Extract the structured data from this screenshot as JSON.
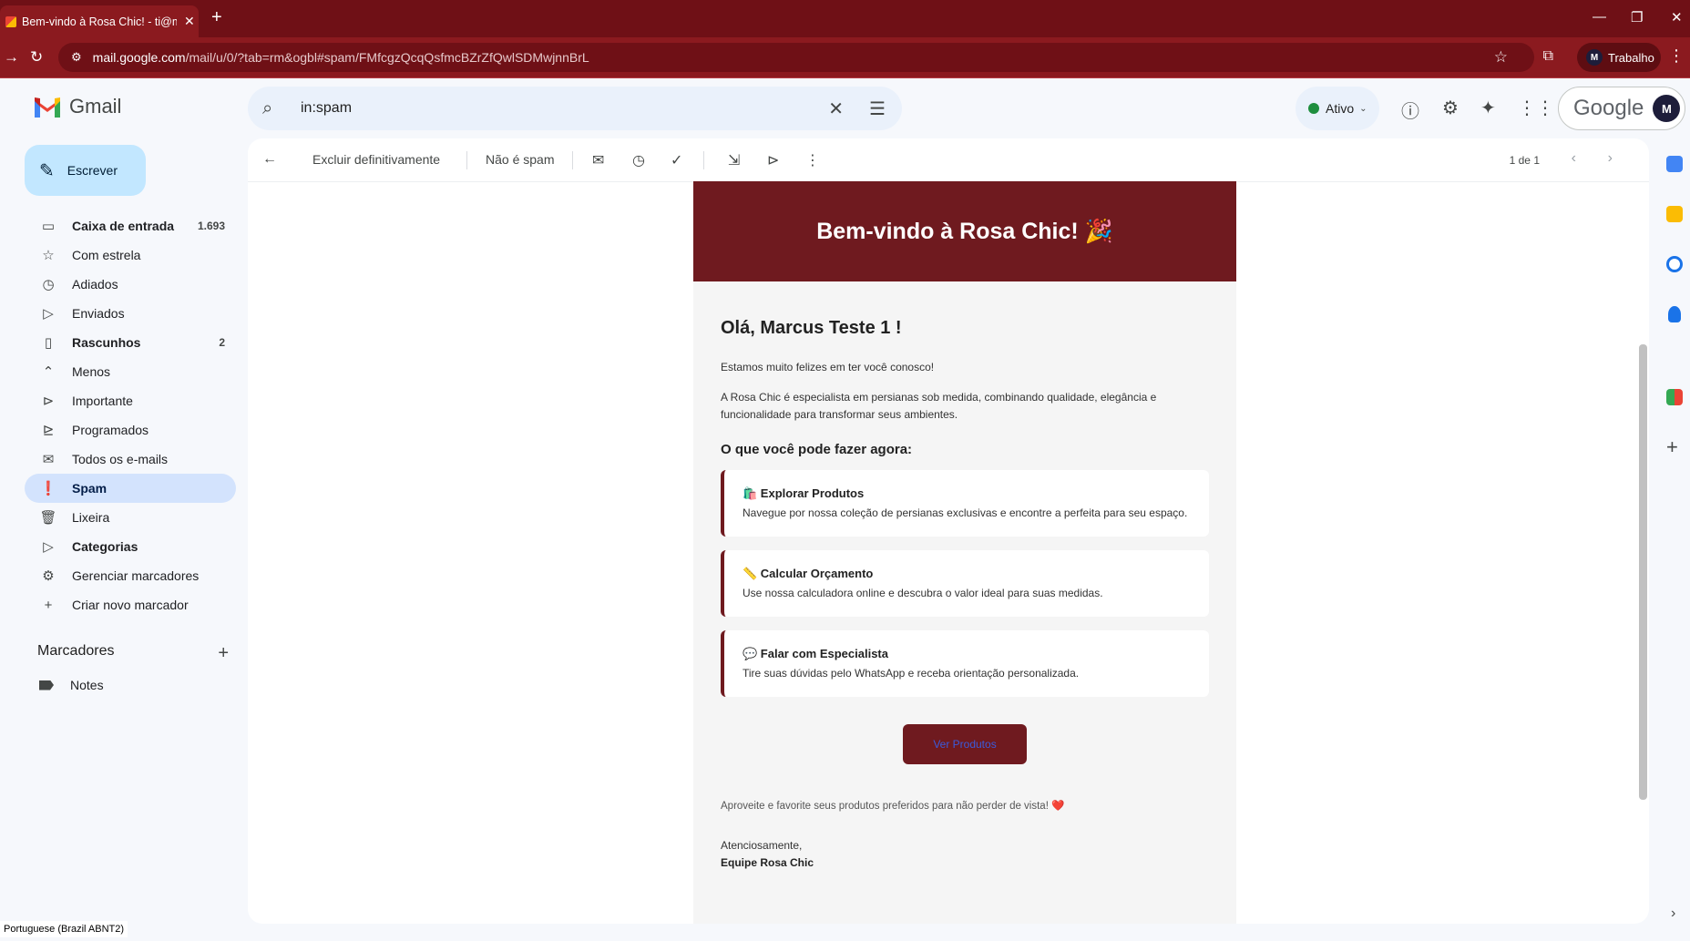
{
  "browser": {
    "tab_title": "Bem-vindo à Rosa Chic! - ti@m",
    "url_host": "mail.google.com",
    "url_path": "/mail/u/0/?tab=rm&ogbl#spam/FMfcgzQcqQsfmcBZrZfQwlSDMwjnnBrL",
    "profile_label": "Trabalho",
    "profile_initial": "M"
  },
  "gmail": {
    "app_name": "Gmail",
    "search_query": "in:spam",
    "status": "Ativo",
    "google_word": "Google",
    "account_initial": "M"
  },
  "sidebar": {
    "compose_label": "Escrever",
    "items": [
      {
        "label": "Caixa de entrada",
        "count": "1.693",
        "icon": "inbox-icon",
        "glyph": "▭",
        "bold": true
      },
      {
        "label": "Com estrela",
        "count": "",
        "icon": "star-icon",
        "glyph": "☆"
      },
      {
        "label": "Adiados",
        "count": "",
        "icon": "clock-icon",
        "glyph": "◷"
      },
      {
        "label": "Enviados",
        "count": "",
        "icon": "send-icon",
        "glyph": "▷"
      },
      {
        "label": "Rascunhos",
        "count": "2",
        "icon": "draft-icon",
        "glyph": "▯",
        "bold": true
      },
      {
        "label": "Menos",
        "count": "",
        "icon": "chevron-up-icon",
        "glyph": "⌃"
      },
      {
        "label": "Importante",
        "count": "",
        "icon": "important-icon",
        "glyph": "⊳"
      },
      {
        "label": "Programados",
        "count": "",
        "icon": "scheduled-icon",
        "glyph": "⊵"
      },
      {
        "label": "Todos os e-mails",
        "count": "",
        "icon": "all-mail-icon",
        "glyph": "✉"
      },
      {
        "label": "Spam",
        "count": "",
        "icon": "spam-icon",
        "glyph": "❗",
        "active": true
      },
      {
        "label": "Lixeira",
        "count": "",
        "icon": "trash-icon",
        "glyph": "🗑"
      },
      {
        "label": "Categorias",
        "count": "",
        "icon": "label-icon",
        "glyph": "▷",
        "bold": true
      },
      {
        "label": "Gerenciar marcadores",
        "count": "",
        "icon": "gear-icon",
        "glyph": "⚙"
      },
      {
        "label": "Criar novo marcador",
        "count": "",
        "icon": "plus-icon",
        "glyph": "+"
      }
    ],
    "labels_title": "Marcadores",
    "labels": [
      {
        "label": "Notes"
      }
    ]
  },
  "toolbar": {
    "delete_forever": "Excluir definitivamente",
    "not_spam": "Não é spam",
    "pager": "1 de 1"
  },
  "email": {
    "hero_title": "Bem-vindo à Rosa Chic! 🎉",
    "greeting": "Olá, Marcus Teste 1 !",
    "intro": "Estamos muito felizes em ter você conosco!",
    "about": "A Rosa Chic é especialista em persianas sob medida, combinando qualidade, elegância e funcionalidade para transformar seus ambientes.",
    "subtitle": "O que você pode fazer agora:",
    "cards": [
      {
        "title": "🛍️ Explorar Produtos",
        "text": "Navegue por nossa coleção de persianas exclusivas e encontre a perfeita para seu espaço."
      },
      {
        "title": "📏 Calcular Orçamento",
        "text": "Use nossa calculadora online e descubra o valor ideal para suas medidas."
      },
      {
        "title": "💬 Falar com Especialista",
        "text": "Tire suas dúvidas pelo WhatsApp e receba orientação personalizada."
      }
    ],
    "cta": "Ver Produtos",
    "footer_note": "Aproveite e favorite seus produtos preferidos para não perder de vista! ❤️",
    "signoff": "Atenciosamente,",
    "signature": "Equipe Rosa Chic"
  },
  "statusbar": {
    "keyboard": "Portuguese (Brazil ABNT2)"
  },
  "colors": {
    "brand": "#6f1a1f",
    "chrome": "#8b1a1f",
    "active_nav": "#d3e3fd",
    "compose": "#c2e7ff"
  }
}
